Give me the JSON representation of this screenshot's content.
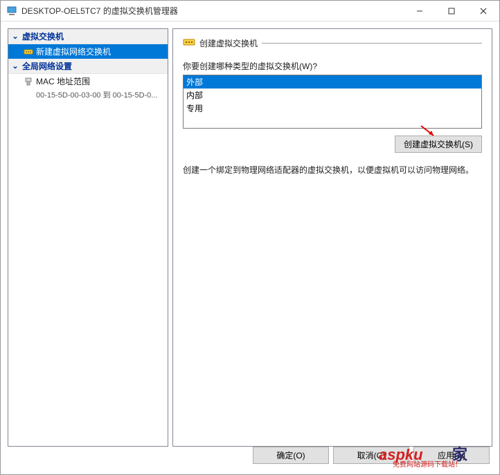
{
  "window": {
    "title": "DESKTOP-OEL5TC7 的虚拟交换机管理器"
  },
  "tree": {
    "section1": {
      "header": "虚拟交换机",
      "item_new": "新建虚拟网络交换机"
    },
    "section2": {
      "header": "全局网络设置",
      "mac_label": "MAC 地址范围",
      "mac_range": "00-15-5D-00-03-00 到 00-15-5D-0..."
    }
  },
  "right": {
    "section_title": "创建虚拟交换机",
    "prompt": "你要创建哪种类型的虚拟交换机(W)?",
    "options": {
      "external": "外部",
      "internal": "内部",
      "private": "专用"
    },
    "create_button": "创建虚拟交换机(S)",
    "description": "创建一个绑定到物理网络适配器的虚拟交换机，以便虚拟机可以访问物理网络。"
  },
  "footer": {
    "ok": "确定(O)",
    "cancel": "取消(C)",
    "apply": "应用(A)"
  },
  "watermark": {
    "text1": "aspku",
    "text2": "家",
    "text3": "免费网站源码下载站！"
  }
}
